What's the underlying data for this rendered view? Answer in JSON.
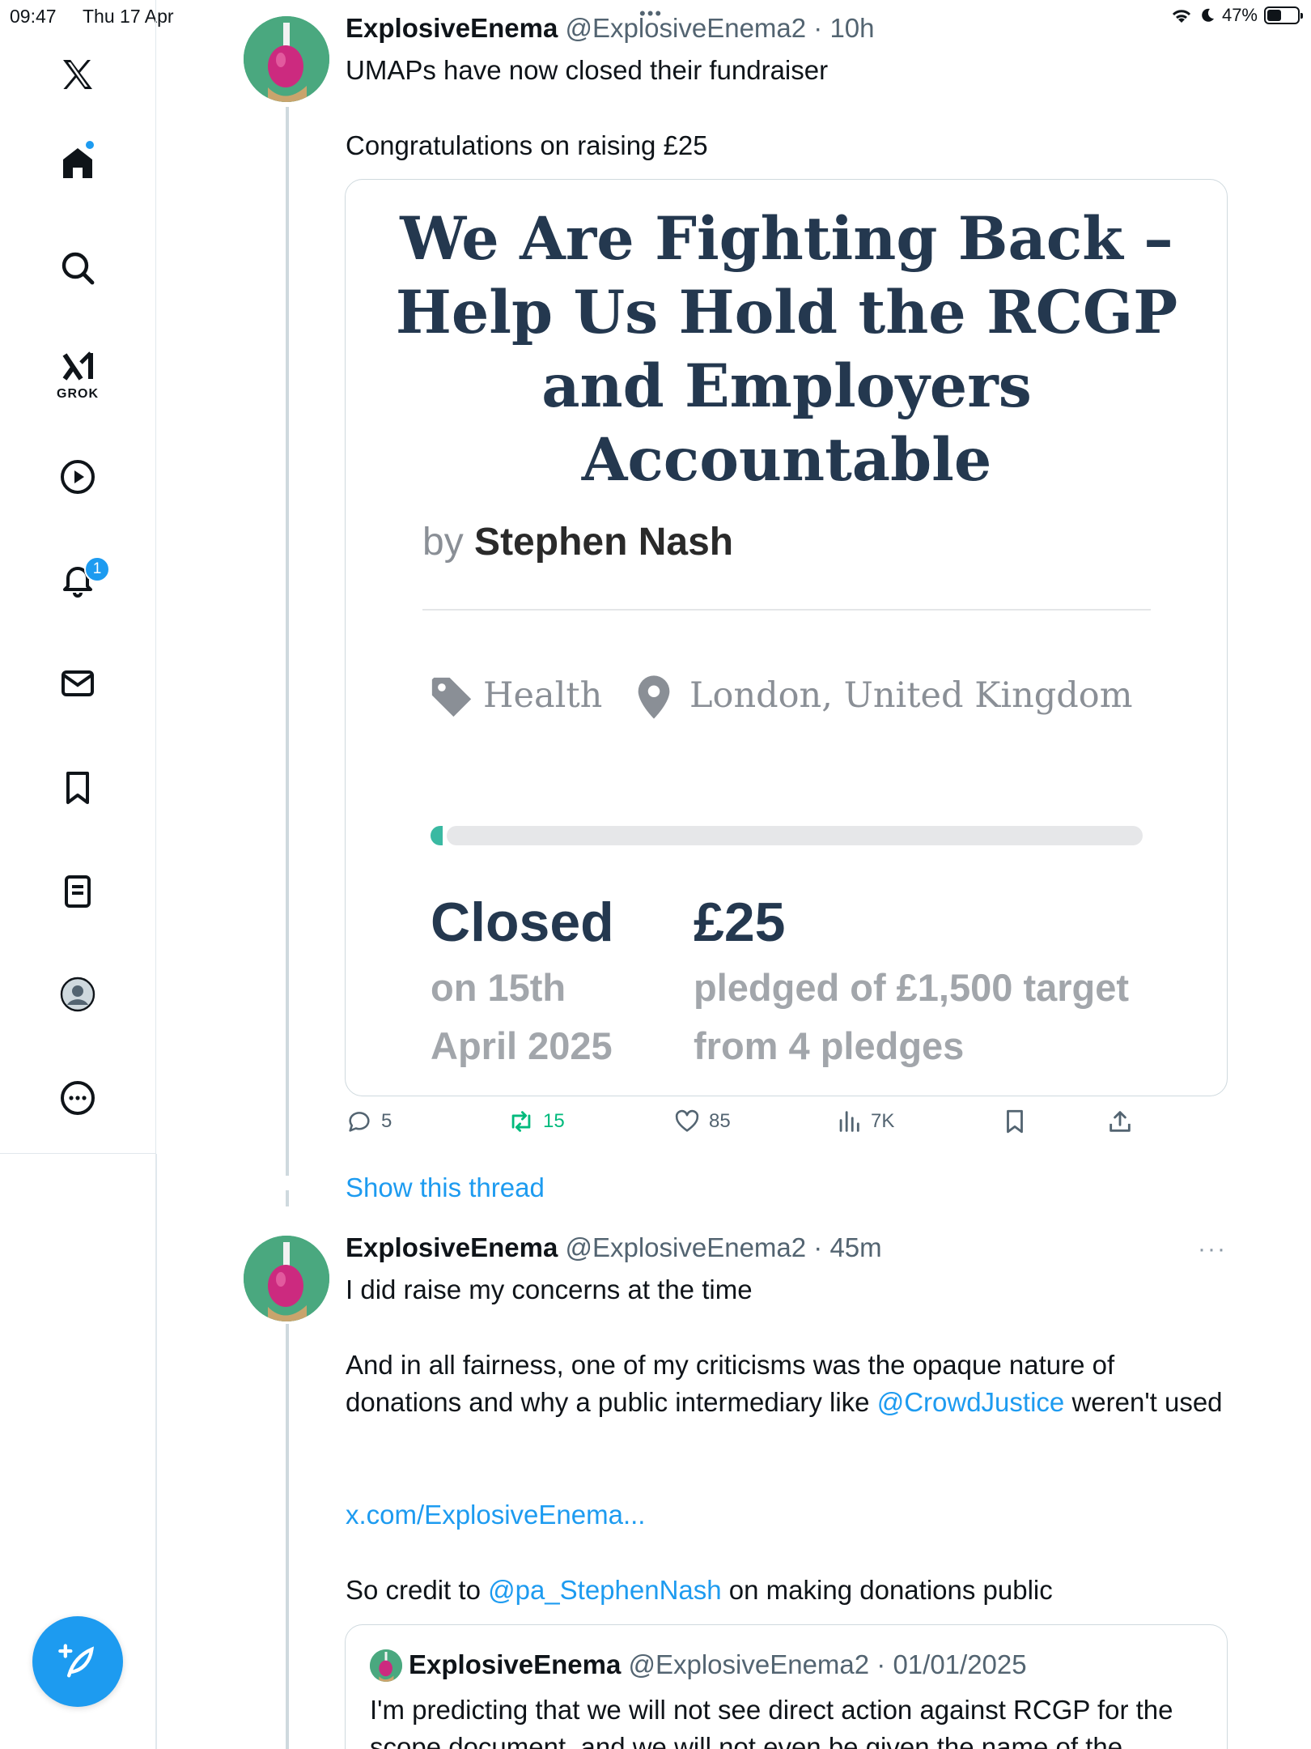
{
  "status_bar": {
    "time": "09:47",
    "date": "Thu 17 Apr",
    "battery": "47%",
    "battery_level": 0.47
  },
  "sidebar": {
    "grok_label": "GROK",
    "notifications_badge": "1",
    "items": [
      "x-logo",
      "home-icon",
      "search-icon",
      "grok-icon",
      "video-icon",
      "bell-icon",
      "mail-icon",
      "bookmark-icon",
      "lists-icon",
      "profile-icon",
      "more-icon"
    ]
  },
  "tweets": [
    {
      "name": "ExplosiveEnema",
      "handle": "@ExplosiveEnema2",
      "time": "10h",
      "text_line1": "UMAPs have now closed their fundraiser",
      "text_line2": "Congratulations on raising £25",
      "card": {
        "title_lines": [
          "We Are Fighting Back –",
          "Help Us Hold the RCGP",
          "and Employers",
          "Accountable"
        ],
        "by": "by",
        "author": "Stephen Nash",
        "category": "Health",
        "location": "London, United Kingdom",
        "progress_fraction": 0.0167,
        "status": "Closed",
        "closed_line1": "on 15th",
        "closed_line2": "April 2025",
        "amount": "£25",
        "pledged_line1": "pledged of £1,500 target",
        "pledged_line2": "from 4 pledges"
      },
      "actions": {
        "replies": "5",
        "retweets": "15",
        "likes": "85",
        "views": "7K"
      },
      "show_thread": "Show this thread"
    },
    {
      "name": "ExplosiveEnema",
      "handle": "@ExplosiveEnema2",
      "time": "45m",
      "p1": "I did raise my concerns at the time",
      "p2_a": "And in all fairness, one of my criticisms was the opaque nature of donations and why a public intermediary like ",
      "p2_mention": "@CrowdJustice",
      "p2_b": " weren't used",
      "link": "x.com/ExplosiveEnema...",
      "p3_a": "So credit to ",
      "p3_mention": "@pa_StephenNash",
      "p3_b": " on making donations public",
      "quote": {
        "name": "ExplosiveEnema",
        "handle": "@ExplosiveEnema2",
        "date": "01/01/2025",
        "text": "I'm predicting that we will not see direct action against RCGP for the scope document, and we will not even be given the name of the"
      }
    }
  ],
  "colors": {
    "accent": "#1d9bf0",
    "retweet": "#00ba7c",
    "card_title": "#24384f",
    "progress": "#3ab9a2"
  }
}
